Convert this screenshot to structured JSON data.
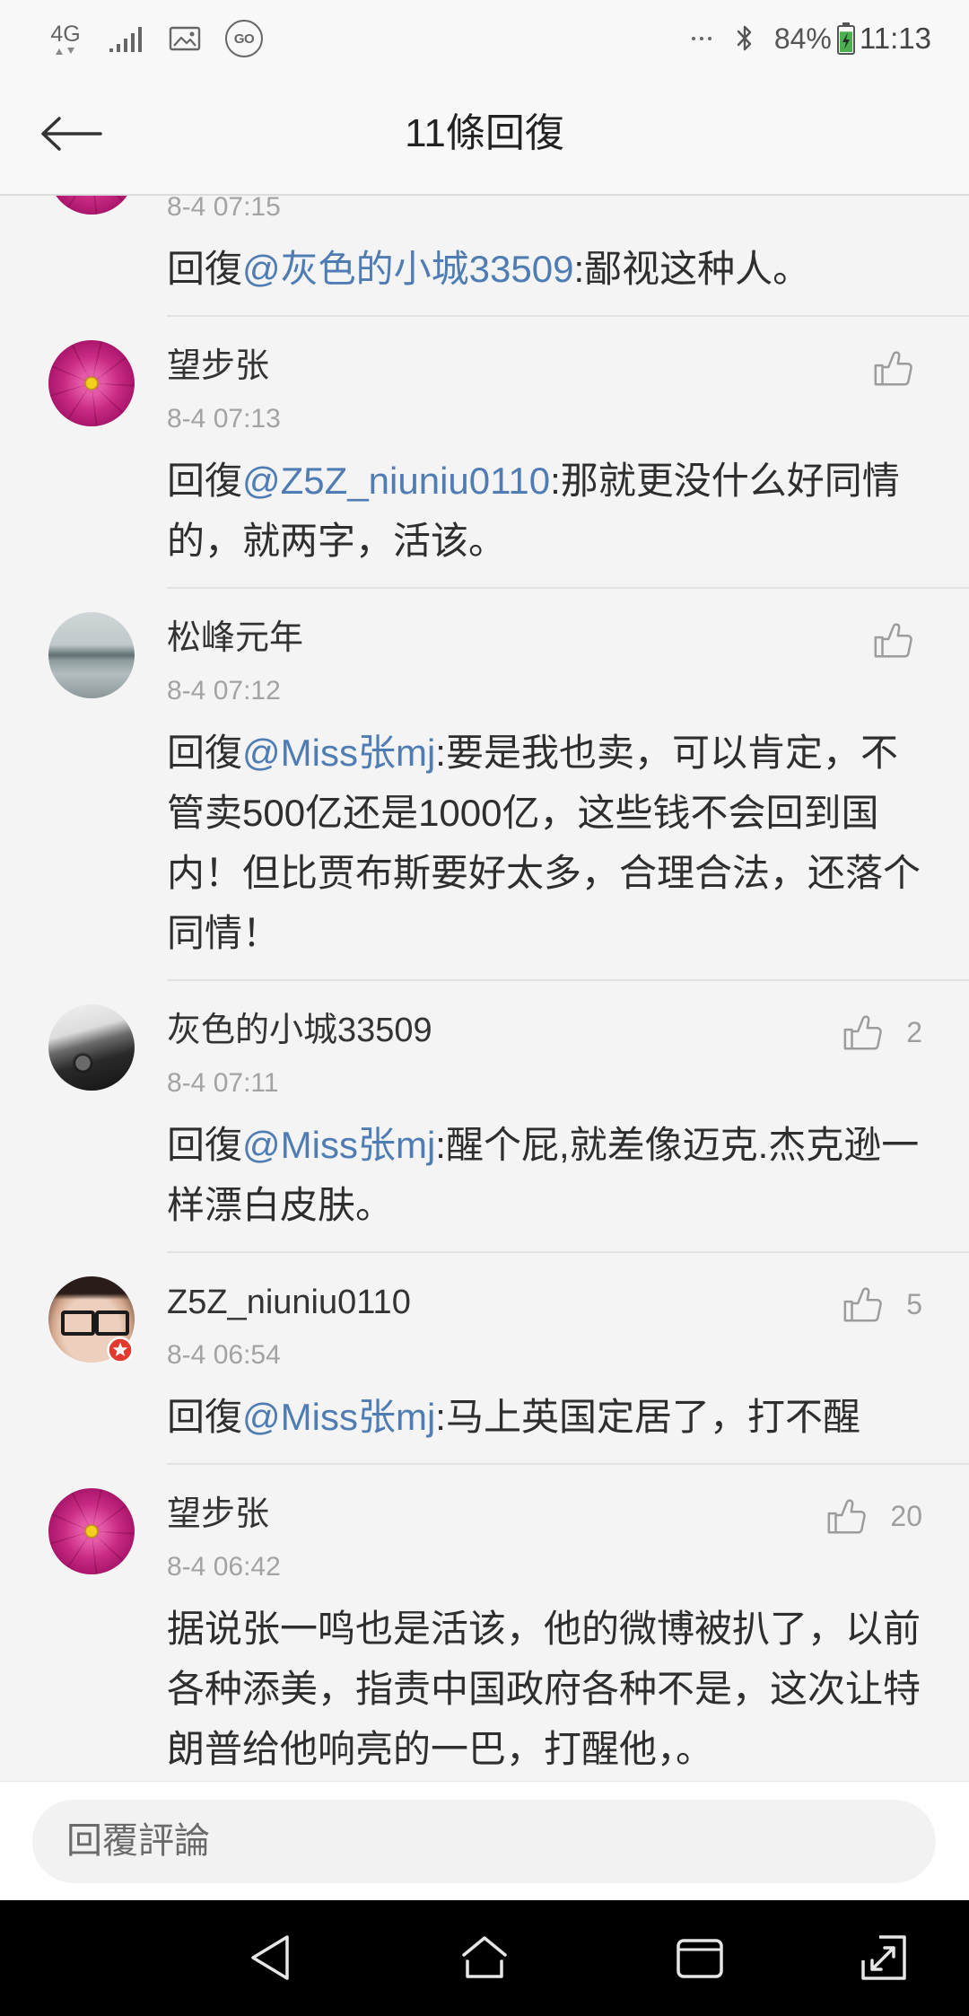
{
  "status_bar": {
    "network": "4G",
    "go_badge": "GO",
    "battery_text": "84%",
    "battery_level": 84,
    "time": "11:13"
  },
  "header": {
    "title": "11條回復"
  },
  "comments": [
    {
      "time": "8-4 07:15",
      "reply_prefix": "回復",
      "mention": "@灰色的小城33509",
      "body": ":鄙视这种人。"
    },
    {
      "name": "望步张",
      "time": "8-4 07:13",
      "reply_prefix": "回復",
      "mention": "@Z5Z_niuniu0110",
      "body": ":那就更没什么好同情的，就两字，活该。"
    },
    {
      "name": "松峰元年",
      "time": "8-4 07:12",
      "reply_prefix": "回復",
      "mention": "@Miss张mj",
      "body": ":要是我也卖，可以肯定，不管卖500亿还是1000亿，这些钱不会回到国内！但比贾布斯要好太多，合理合法，还落个同情！"
    },
    {
      "name": "灰色的小城33509",
      "time": "8-4 07:11",
      "likes": "2",
      "reply_prefix": "回復",
      "mention": "@Miss张mj",
      "body": ":醒个屁,就差像迈克.杰克逊一样漂白皮肤。"
    },
    {
      "name": "Z5Z_niuniu0110",
      "time": "8-4 06:54",
      "likes": "5",
      "reply_prefix": "回復",
      "mention": "@Miss张mj",
      "body": ":马上英国定居了，打不醒"
    },
    {
      "name": "望步张",
      "time": "8-4 06:42",
      "likes": "20",
      "body": "据说张一鸣也是活该，他的微博被扒了，以前各种添美，指责中国政府各种不是，这次让特朗普给他响亮的一巴，打醒他，。"
    }
  ],
  "reply_bar": {
    "placeholder": "回覆評論"
  },
  "icons": {
    "status": [
      "network-4g-icon",
      "signal-strength-icon",
      "image-notification-icon",
      "go-app-icon",
      "more-notifications-icon",
      "bluetooth-icon",
      "battery-charging-icon"
    ],
    "header": "back-arrow-icon",
    "comment": "thumbs-up-icon",
    "nav": [
      "nav-back-icon",
      "nav-home-icon",
      "nav-recents-icon",
      "nav-screen-expand-icon"
    ]
  },
  "colors": {
    "mention": "#4f7db3",
    "text": "#2e2e2e",
    "meta": "#a3a3a3",
    "battery": "#4caf50",
    "badge": "#e23b2e"
  }
}
